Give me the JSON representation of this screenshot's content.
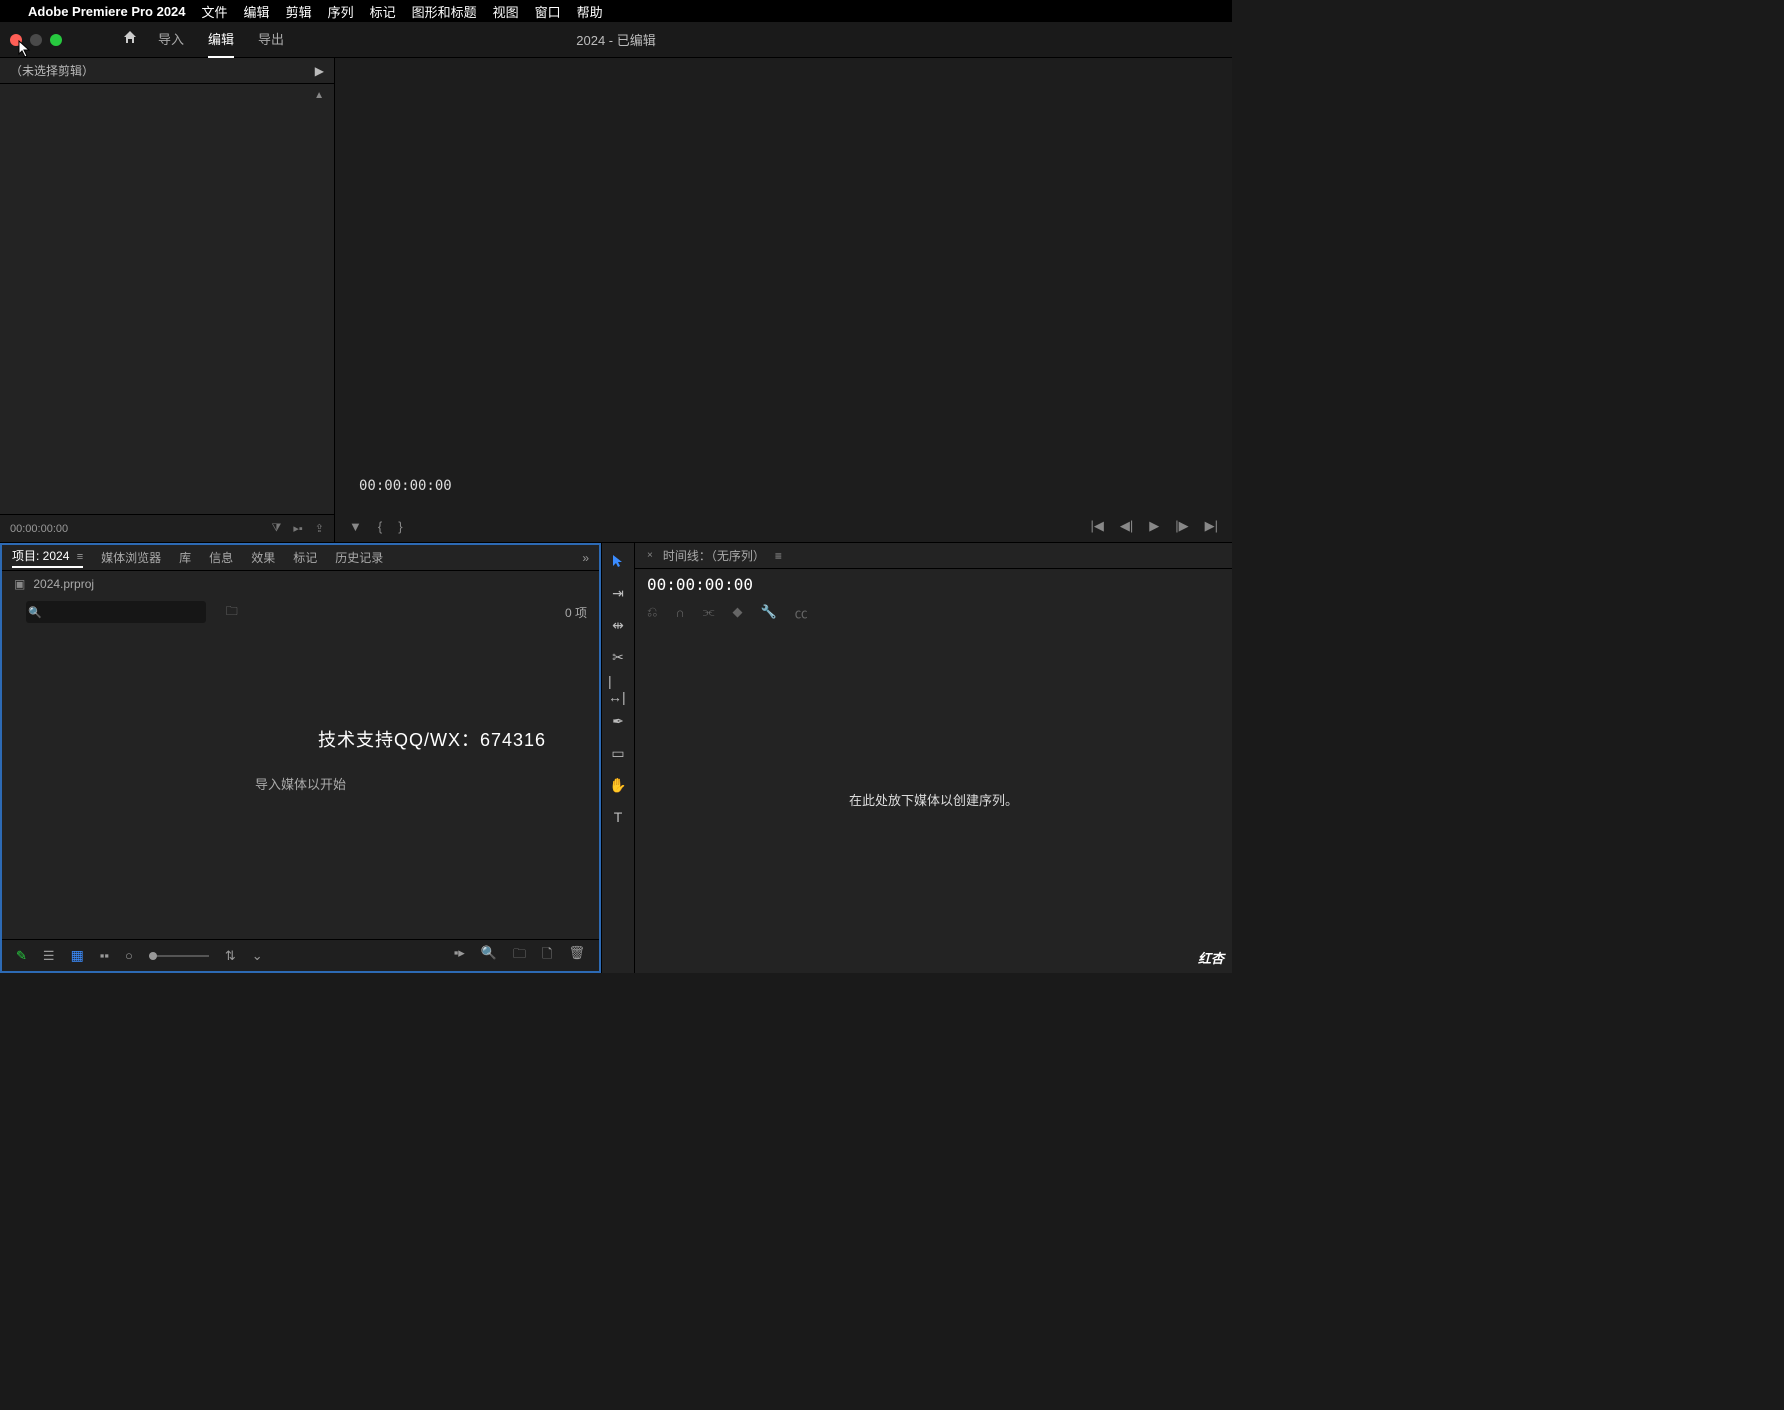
{
  "menubar": {
    "app": "Adobe Premiere Pro 2024",
    "items": [
      "文件",
      "编辑",
      "剪辑",
      "序列",
      "标记",
      "图形和标题",
      "视图",
      "窗口",
      "帮助"
    ]
  },
  "header": {
    "modes": {
      "import": "导入",
      "edit": "编辑",
      "export": "导出"
    },
    "status": "2024 - 已编辑"
  },
  "source": {
    "title": "（未选择剪辑）",
    "timecode": "00:00:00:00"
  },
  "program": {
    "timecode": "00:00:00:00"
  },
  "project": {
    "tabs": {
      "project": "项目: 2024",
      "media_browser": "媒体浏览器",
      "library": "库",
      "info": "信息",
      "effects": "效果",
      "markers": "标记",
      "history": "历史记录"
    },
    "file": "2024.prproj",
    "item_count": "0 项",
    "empty_msg": "导入媒体以开始"
  },
  "timeline": {
    "title": "时间线：（无序列）",
    "timecode": "00:00:00:00",
    "empty_msg": "在此处放下媒体以创建序列。"
  },
  "watermark": "技术支持QQ/WX：674316",
  "corner_logo": "红杏"
}
